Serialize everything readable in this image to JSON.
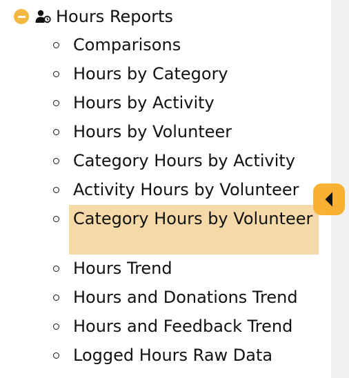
{
  "section": {
    "title": "Hours Reports",
    "toggle_icon": "minus-circle-icon",
    "header_icon": "user-clock-icon",
    "accent_color": "#f4b740"
  },
  "reports": [
    {
      "label": "Comparisons",
      "selected": false
    },
    {
      "label": "Hours by Category",
      "selected": false
    },
    {
      "label": "Hours by Activity",
      "selected": false
    },
    {
      "label": "Hours by Volunteer",
      "selected": false
    },
    {
      "label": "Category Hours by Activity",
      "selected": false
    },
    {
      "label": "Activity Hours by Volunteer",
      "selected": false
    },
    {
      "label": "Category Hours by Volunteer",
      "selected": true
    },
    {
      "label": "Hours Trend",
      "selected": false
    },
    {
      "label": "Hours and Donations Trend",
      "selected": false
    },
    {
      "label": "Hours and Feedback Trend",
      "selected": false
    },
    {
      "label": "Logged Hours Raw Data",
      "selected": false
    }
  ],
  "selection_color": "#f6d9a8",
  "sidebar_toggle": {
    "icon": "caret-left-icon",
    "color": "#f8b133"
  }
}
